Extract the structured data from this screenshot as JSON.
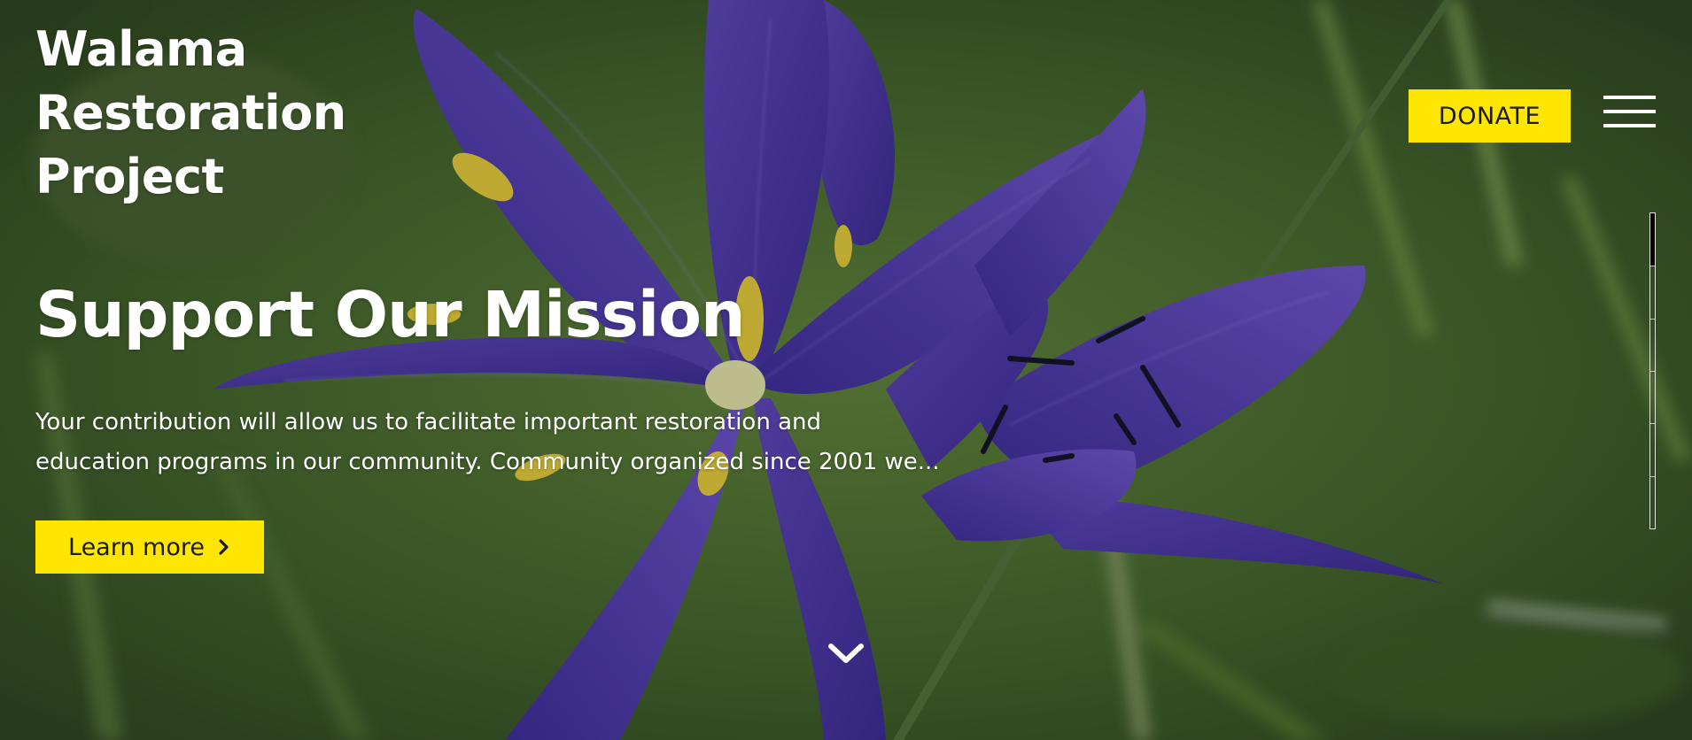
{
  "site": {
    "title_lines": [
      "Walama",
      "Restoration",
      "Project"
    ]
  },
  "header": {
    "donate_label": "DONATE",
    "menu_icon": "hamburger-menu-icon"
  },
  "hero": {
    "heading": "Support Our Mission",
    "text_lines": [
      "Your contribution will allow us to facilitate important restoration and",
      "education programs in our community. Community organized since 2001 we..."
    ],
    "cta_label": "Learn more",
    "cta_icon": "chevron-right-icon",
    "scroll_icon": "chevron-down-icon"
  },
  "slider": {
    "total_slides": 6,
    "current_slide": 1
  },
  "colors": {
    "accent": "#ffe600",
    "text": "#ffffff",
    "button_text": "#1c1c1c"
  }
}
